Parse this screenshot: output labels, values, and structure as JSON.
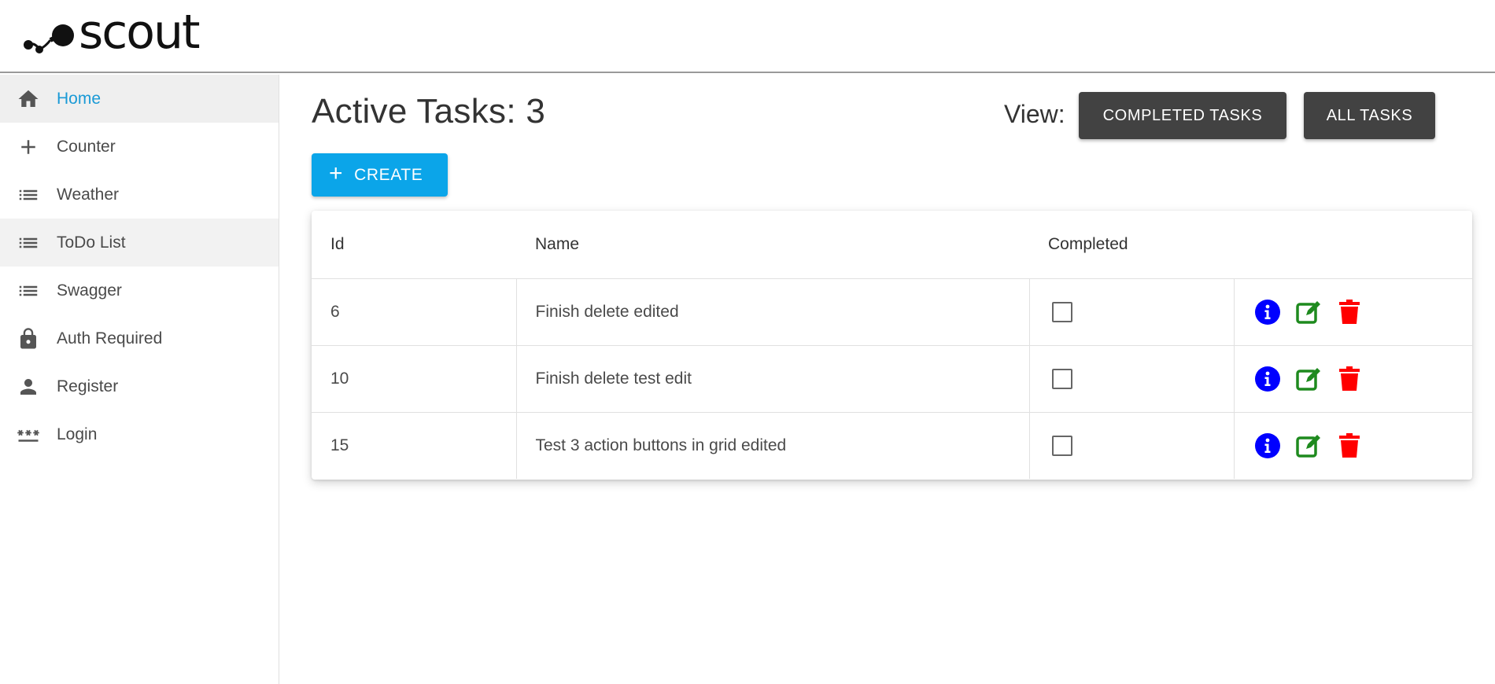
{
  "app": {
    "logo_text": "scout"
  },
  "sidebar": {
    "items": [
      {
        "label": "Home",
        "icon": "home-icon"
      },
      {
        "label": "Counter",
        "icon": "plus-icon"
      },
      {
        "label": "Weather",
        "icon": "list-icon"
      },
      {
        "label": "ToDo List",
        "icon": "list-icon"
      },
      {
        "label": "Swagger",
        "icon": "list-icon"
      },
      {
        "label": "Auth Required",
        "icon": "lock-icon"
      },
      {
        "label": "Register",
        "icon": "person-icon"
      },
      {
        "label": "Login",
        "icon": "password-icon"
      }
    ]
  },
  "main": {
    "title": "Active Tasks: 3",
    "view_label": "View:",
    "completed_tasks_label": "COMPLETED TASKS",
    "all_tasks_label": "ALL TASKS",
    "create_label": "CREATE",
    "create_icon": "+"
  },
  "table": {
    "headers": {
      "id": "Id",
      "name": "Name",
      "completed": "Completed"
    },
    "rows": [
      {
        "id": "6",
        "name": "Finish delete edited",
        "completed": false
      },
      {
        "id": "10",
        "name": "Finish delete test edit",
        "completed": false
      },
      {
        "id": "15",
        "name": "Test 3 action buttons in grid edited",
        "completed": false
      }
    ]
  },
  "colors": {
    "accent": "#1a9ad6",
    "create_button": "#0ba5e9",
    "dark_button": "#424242",
    "info_icon": "#0000ff",
    "edit_icon": "#1e8a1e",
    "delete_icon": "#ff0000"
  }
}
